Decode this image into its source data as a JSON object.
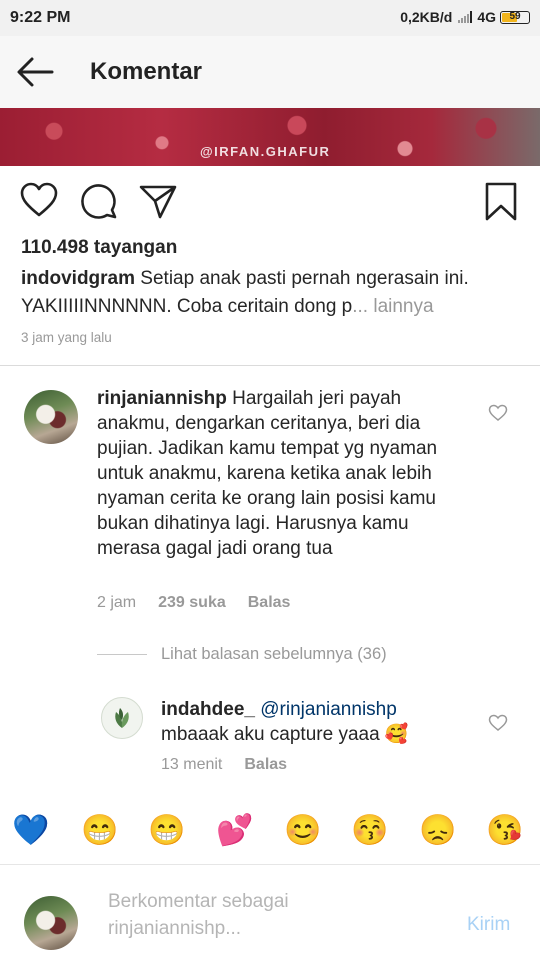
{
  "status_bar": {
    "time": "9:22 PM",
    "network_speed": "0,2KB/d",
    "network_type": "4G",
    "battery_level": "59",
    "battery_color": "#f2b51d"
  },
  "header": {
    "back_icon": "arrow-left-icon",
    "title": "Komentar"
  },
  "video": {
    "watermark": "@IRFAN.GHAFUR"
  },
  "post": {
    "action_icons": [
      "heart-outline-icon",
      "comment-bubble-icon",
      "share-direct-icon",
      "bookmark-icon"
    ],
    "views": "110.498 tayangan",
    "caption_user": "indovidgram",
    "caption_text": " Setiap anak pasti pernah ngerasain ini. YAKIIIIINNNNNN. Coba ceritain dong p",
    "caption_more": "... lainnya",
    "time_ago": "3 jam yang lalu"
  },
  "comments": [
    {
      "user": "rinjaniannishp",
      "text": " Hargailah jeri payah anakmu, dengarkan ceritanya, beri dia pujian. Jadikan kamu tempat yg nyaman untuk anakmu, karena ketika anak lebih nyaman cerita ke orang lain posisi kamu bukan dihatinya lagi. Harusnya kamu merasa gagal jadi orang tua",
      "time": "2 jam",
      "likes": "239 suka",
      "reply_label": "Balas"
    }
  ],
  "view_replies": "Lihat balasan sebelumnya (36)",
  "reply": {
    "user": "indahdee_",
    "mention": "@rinjaniannishp",
    "text": "mbaaak aku capture yaaa",
    "emoji": "🥰",
    "time": "13 menit",
    "reply_label": "Balas"
  },
  "emoji_bar": [
    "💙",
    "😁",
    "😁",
    "💕",
    "😊",
    "😚",
    "😞",
    "😘"
  ],
  "composer": {
    "placeholder_line1": "Berkomentar sebagai",
    "placeholder_line2": "rinjaniannishp...",
    "send_label": "Kirim"
  },
  "colors": {
    "link": "#003569",
    "muted": "#999999",
    "send_disabled": "#a8d1f5"
  }
}
